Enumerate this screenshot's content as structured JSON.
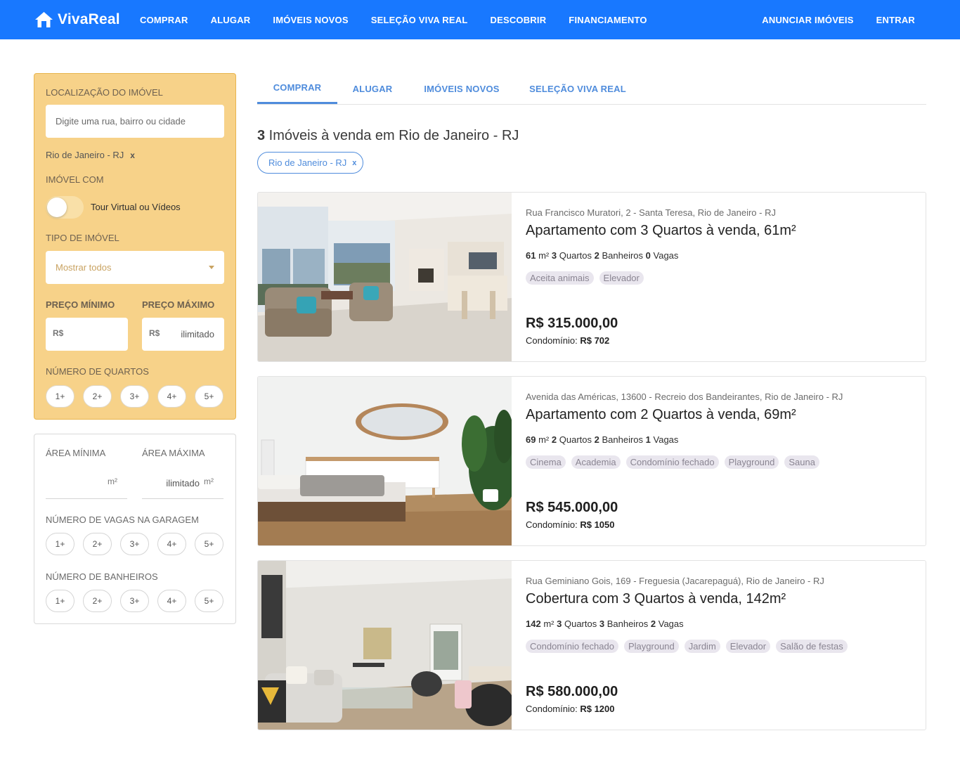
{
  "header": {
    "brand": "VivaReal",
    "nav": [
      "COMPRAR",
      "ALUGAR",
      "IMÓVEIS NOVOS",
      "SELEÇÃO VIVA REAL",
      "DESCOBRIR",
      "FINANCIAMENTO"
    ],
    "nav_right": [
      "ANUNCIAR IMÓVEIS",
      "ENTRAR"
    ],
    "color": "#1878ff"
  },
  "filters": {
    "location_label": "LOCALIZAÇÃO DO IMÓVEL",
    "location_placeholder": "Digite uma rua, bairro ou cidade",
    "location_chip": "Rio de Janeiro - RJ",
    "chip_remove": "x",
    "feature_label": "IMÓVEL COM",
    "toggle_label": "Tour Virtual ou Vídeos",
    "type_label": "TIPO DE IMÓVEL",
    "type_value": "Mostrar todos",
    "price_min_label": "PREÇO MÍNIMO",
    "price_max_label": "PREÇO MÁXIMO",
    "currency": "R$",
    "price_max_value": "ilimitado",
    "rooms_label": "NÚMERO DE QUARTOS",
    "area_min_label": "ÁREA MÍNIMA",
    "area_max_label": "ÁREA MÁXIMA",
    "area_unit": "m²",
    "area_max_value": "ilimitado",
    "garage_label": "NÚMERO DE VAGAS NA GARAGEM",
    "bath_label": "NÚMERO DE BANHEIROS",
    "options": [
      "1+",
      "2+",
      "3+",
      "4+",
      "5+"
    ],
    "accent_color": "#f7d289"
  },
  "tabs": [
    "COMPRAR",
    "ALUGAR",
    "IMÓVEIS NOVOS",
    "SELEÇÃO VIVA REAL"
  ],
  "results": {
    "count": "3",
    "title_rest": " Imóveis à venda em Rio de Janeiro - RJ",
    "chip": "Rio de Janeiro - RJ",
    "chip_remove": "x"
  },
  "listings": [
    {
      "address": "Rua Francisco Muratori, 2 - Santa Teresa, Rio de Janeiro - RJ",
      "title": "Apartamento com 3 Quartos à venda, 61m²",
      "area": "61",
      "rooms": "3",
      "baths": "2",
      "garage": "0",
      "tags": [
        "Aceita animais",
        "Elevador"
      ],
      "price": "R$ 315.000,00",
      "condo": "R$ 702"
    },
    {
      "address": "Avenida das Américas, 13600 - Recreio dos Bandeirantes, Rio de Janeiro - RJ",
      "title": "Apartamento com 2 Quartos à venda, 69m²",
      "area": "69",
      "rooms": "2",
      "baths": "2",
      "garage": "1",
      "tags": [
        "Cinema",
        "Academia",
        "Condomínio fechado",
        "Playground",
        "Sauna"
      ],
      "price": "R$ 545.000,00",
      "condo": "R$ 1050"
    },
    {
      "address": "Rua Geminiano Gois, 169 - Freguesia (Jacarepaguá), Rio de Janeiro - RJ",
      "title": "Cobertura com 3 Quartos à venda, 142m²",
      "area": "142",
      "rooms": "3",
      "baths": "3",
      "garage": "2",
      "tags": [
        "Condomínio fechado",
        "Playground",
        "Jardim",
        "Elevador",
        "Salão de festas"
      ],
      "price": "R$ 580.000,00",
      "condo": "R$ 1200"
    }
  ],
  "labels": {
    "area_unit": "m²",
    "rooms": "Quartos",
    "baths": "Banheiros",
    "garage": "Vagas",
    "condo": "Condomínio:"
  }
}
